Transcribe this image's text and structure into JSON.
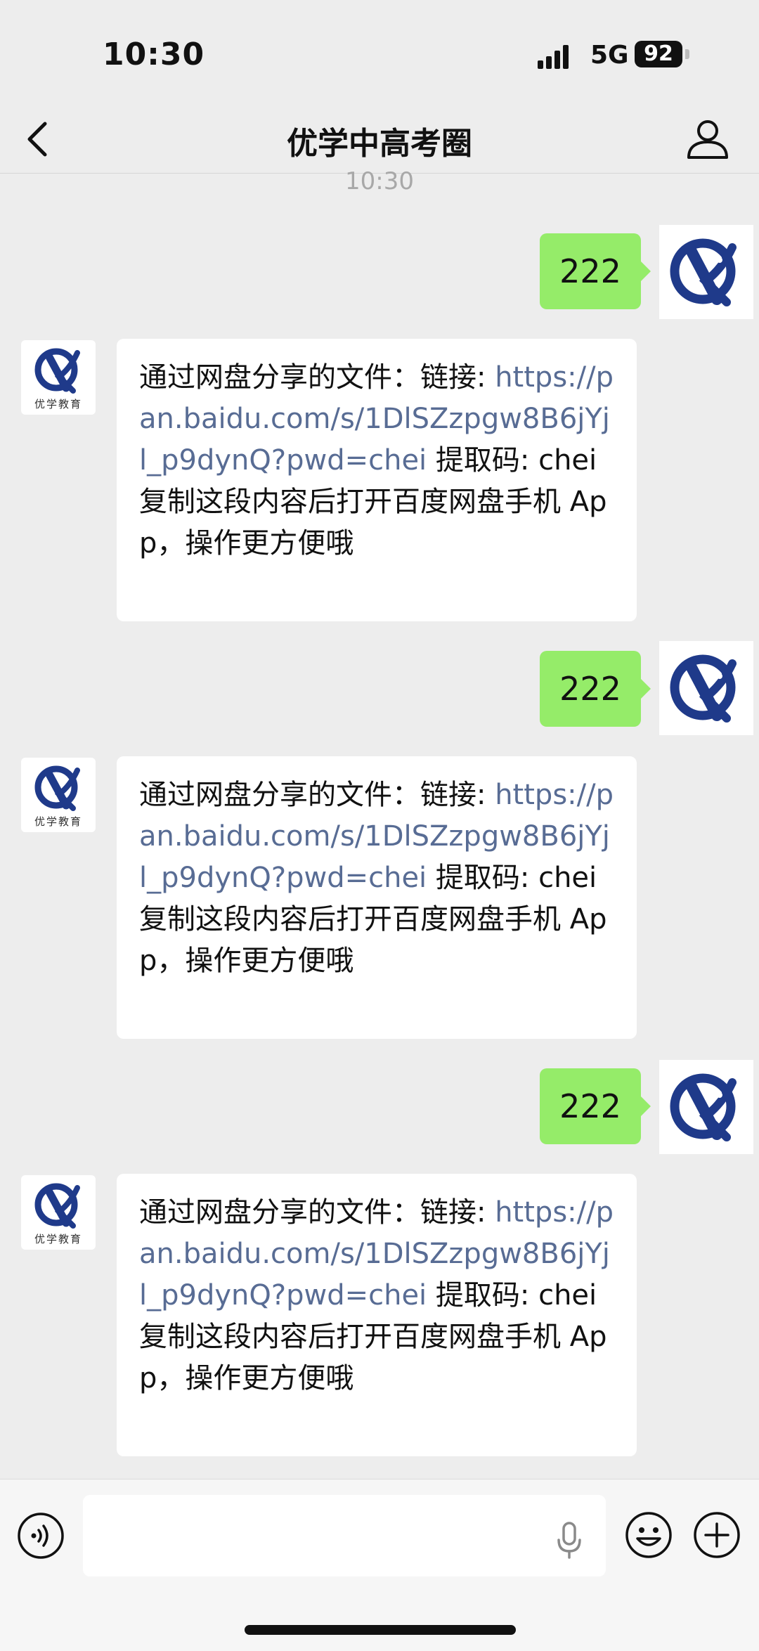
{
  "status_bar": {
    "time": "10:30",
    "network": "5G",
    "battery": "92"
  },
  "header": {
    "title": "优学中高考圈"
  },
  "chat": {
    "timestamp": "10:30",
    "avatar_caption": "优学教育",
    "messages": [
      {
        "sender": "me",
        "text": "222"
      },
      {
        "sender": "other",
        "prefix": "通过网盘分享的文件：链接: ",
        "link": "https://pan.baidu.com/s/1DlSZzpgw8B6jYjl_p9dynQ?pwd=chei",
        "suffix": " 提取码: chei 复制这段内容后打开百度网盘手机 App，操作更方便哦"
      },
      {
        "sender": "me",
        "text": "222"
      },
      {
        "sender": "other",
        "prefix": "通过网盘分享的文件：链接: ",
        "link": "https://pan.baidu.com/s/1DlSZzpgw8B6jYjl_p9dynQ?pwd=chei",
        "suffix": " 提取码: chei 复制这段内容后打开百度网盘手机 App，操作更方便哦"
      },
      {
        "sender": "me",
        "text": "222"
      },
      {
        "sender": "other",
        "prefix": "通过网盘分享的文件：链接: ",
        "link": "https://pan.baidu.com/s/1DlSZzpgw8B6jYjl_p9dynQ?pwd=chei",
        "suffix": " 提取码: chei 复制这段内容后打开百度网盘手机 App，操作更方便哦"
      }
    ]
  },
  "icons": {
    "back": "chevron-left-icon",
    "profile": "person-icon",
    "voice": "voice-mode-icon",
    "mic": "microphone-icon",
    "emoji": "emoji-icon",
    "plus": "plus-icon"
  },
  "colors": {
    "sent_bubble": "#95ec69",
    "link": "#586c94",
    "brand_blue": "#1f3a8a"
  }
}
